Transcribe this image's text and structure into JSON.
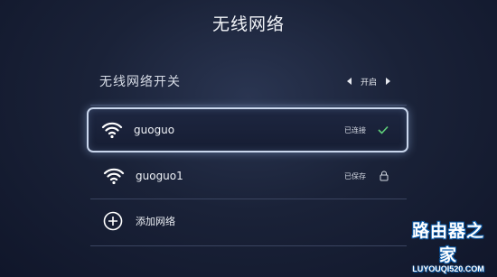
{
  "page": {
    "title": "无线网络"
  },
  "wireless_switch": {
    "label": "无线网络开关",
    "value": "开启"
  },
  "networks": [
    {
      "name": "guoguo",
      "status": "已连接",
      "status_icon": "check-icon",
      "selected": true
    },
    {
      "name": "guoguo1",
      "status": "已保存",
      "status_icon": "lock-icon",
      "selected": false
    }
  ],
  "add_network": {
    "label": "添加网络",
    "icon": "plus-circle-icon"
  },
  "watermark": {
    "logo": "路由器之家",
    "url": "LUYOUQI520.COM"
  },
  "colors": {
    "accent_check": "#5fd07a",
    "background": "#1a2238",
    "focus_border": "#c9d6ec"
  }
}
